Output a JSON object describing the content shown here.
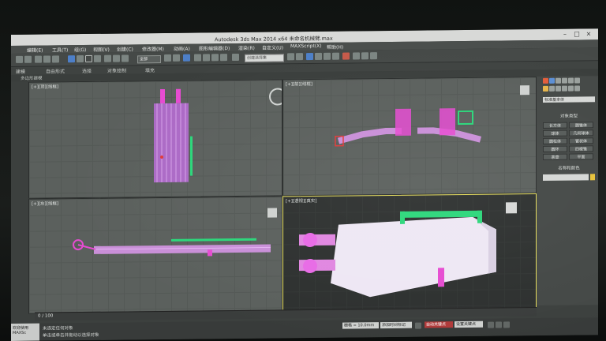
{
  "window": {
    "title": "Autodesk 3ds Max 2014 x64    未命名机械臂.max"
  },
  "menu": {
    "items": [
      "编辑(E)",
      "工具(T)",
      "组(G)",
      "视图(V)",
      "创建(C)",
      "修改器(M)",
      "动画(A)",
      "图形编辑器(D)",
      "渲染(R)",
      "自定义(U)",
      "MAXScript(X)",
      "帮助(H)"
    ]
  },
  "toolbar": {
    "selection_filter": "全部",
    "named_selection_placeholder": "创建选择集"
  },
  "ribbon": {
    "tabs": [
      "建模",
      "自由形式",
      "选择",
      "对象绘制",
      "填充"
    ],
    "sub_label": "多边形建模"
  },
  "viewports": {
    "top_left": "[+][顶][线框]",
    "top_right": "[+][前][线框]",
    "bottom_left": "[+][左][线框]",
    "bottom_right": "[+][透视][真实]"
  },
  "command_panel": {
    "category_dropdown": "标准基本体",
    "rollout_object_type": "对象类型",
    "rollout_name_color": "名称和颜色",
    "buttons": [
      "长方体",
      "圆锥体",
      "球体",
      "几何球体",
      "圆柱体",
      "管状体",
      "圆环",
      "四棱锥",
      "茶壶",
      "平面"
    ]
  },
  "timeline": {
    "frame": "0 / 100"
  },
  "status": {
    "line1": "未选定任何对象",
    "line2": "单击或单击并拖动以选择对象",
    "maxscript": "欢迎使用 MAXSc",
    "grid": "栅格 = 10.0mm",
    "add_time_tag": "添加时间标记",
    "auto_key": "自动关键点",
    "set_key": "设置关键点"
  },
  "colors": {
    "pink_object": "#c98fd8",
    "magenta_part": "#e64bd1",
    "green_bracket": "#2bd67a",
    "active_border": "#e6dd5a",
    "swatch": "#e7c23a"
  }
}
